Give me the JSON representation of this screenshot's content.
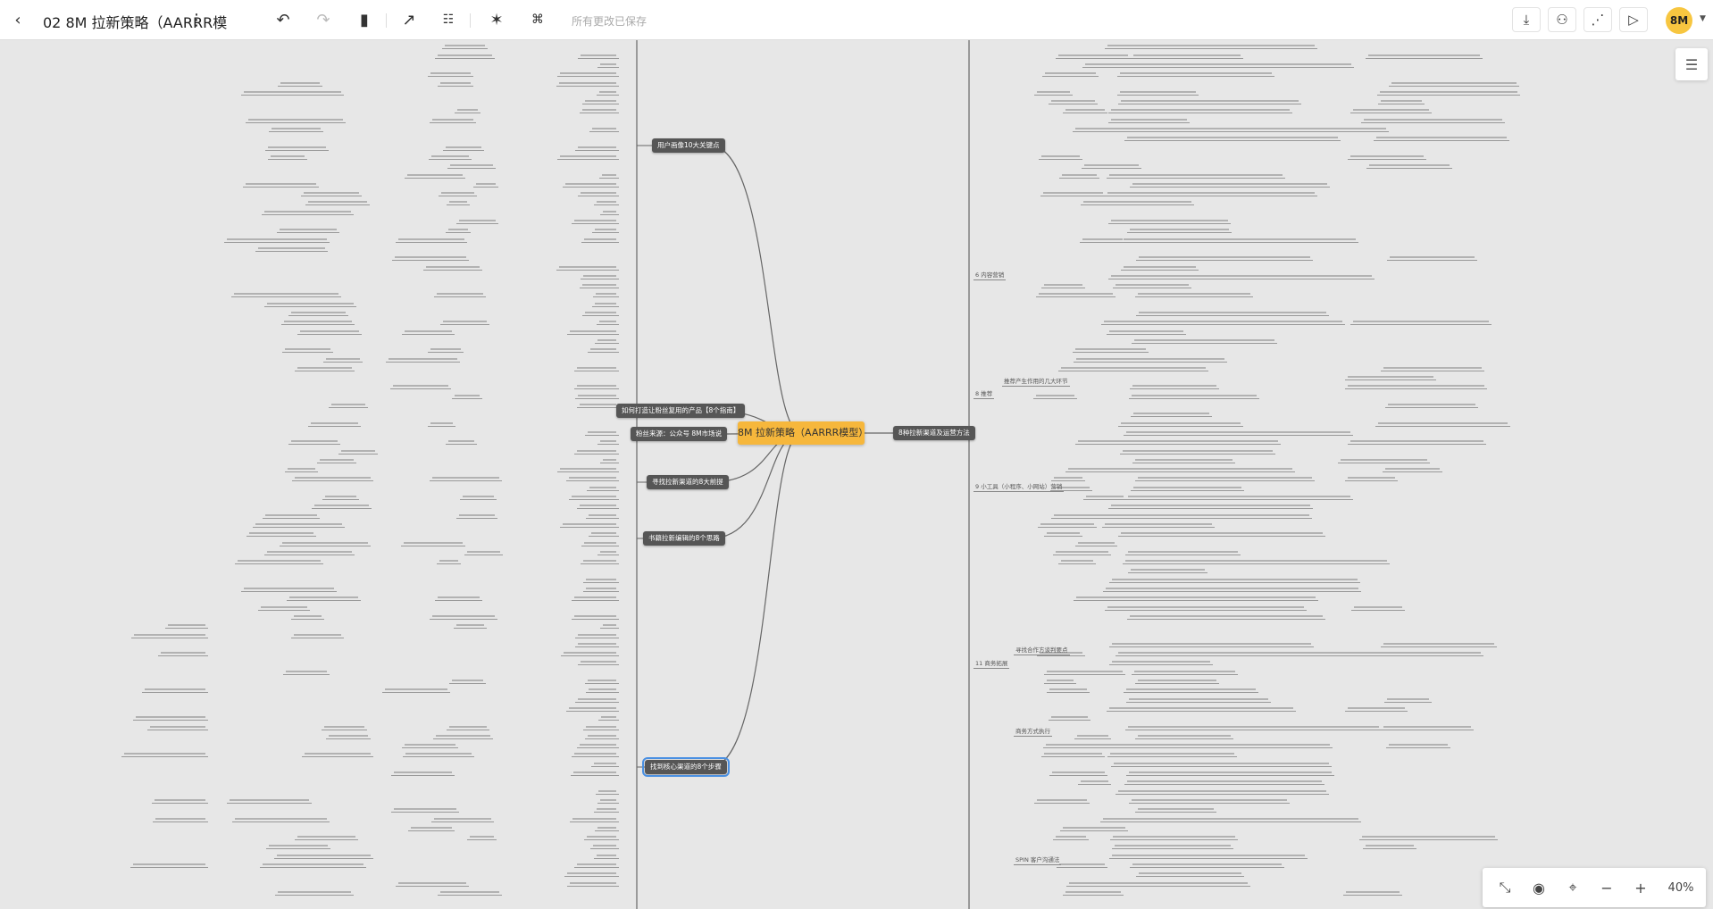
{
  "header": {
    "title": "02 8M 拉新策略（AARRR模",
    "save_status": "所有更改已保存",
    "avatar": "8M"
  },
  "icons": {
    "back": "chevron-left-icon",
    "more": "more-vertical-icon",
    "undo": "undo-icon",
    "redo": "redo-icon",
    "format": "format-painter-icon",
    "link": "arrow-link-icon",
    "outline": "outline-icon",
    "ai": "magic-wand-icon",
    "structure": "structure-icon",
    "download": "download-icon",
    "collab": "users-icon",
    "share": "share-icon",
    "present": "play-icon"
  },
  "mindmap": {
    "root": "8M 拉新策略（AARRR模型）",
    "left": [
      "用户画像10大关键点",
      "如何打造让粉丝复用的产品【8个指南】",
      "粉丝来源：公众号 8M市场说",
      "寻找拉新渠道的8大前提",
      "书籍拉新编辑的8个思路",
      "找到核心渠道的8个步骤"
    ],
    "right": [
      "8种拉新渠道及运营方法"
    ],
    "right_subtopics": [
      "6 内容营销",
      "8 推荐",
      "9 小工具（小程序、小网站）营销",
      "11 商务拓展"
    ],
    "right_level2": [
      "推荐产生作用的几大环节",
      "寻找合作方谈判要点",
      "商务方式执行",
      "SPIN 客户沟通法"
    ]
  },
  "zoom": {
    "level": "40%"
  }
}
